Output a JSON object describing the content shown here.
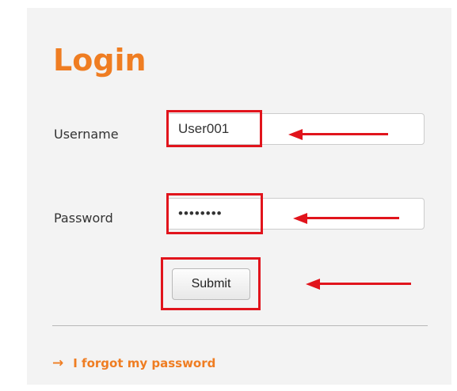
{
  "login": {
    "title": "Login",
    "username_label": "Username",
    "username_value": "User001",
    "password_label": "Password",
    "password_value": "••••••••",
    "submit_label": "Submit",
    "forgot_label": "I forgot my password",
    "forgot_icon": "right-arrow-icon"
  },
  "colors": {
    "accent": "#ef7d22",
    "highlight": "#e1141c",
    "panel_bg": "#f3f3f3"
  }
}
